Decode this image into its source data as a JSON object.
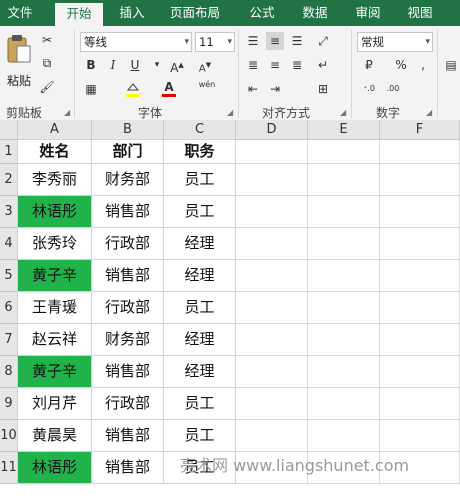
{
  "menu": {
    "tabs": [
      "文件",
      "开始",
      "插入",
      "页面布局",
      "公式",
      "数据",
      "审阅",
      "视图"
    ],
    "active_index": 1
  },
  "ribbon": {
    "clipboard": {
      "paste_label": "粘贴",
      "group_label": "剪贴板"
    },
    "font": {
      "font_name": "等线",
      "font_size": "11",
      "bold_label": "B",
      "italic_label": "I",
      "underline_label": "U",
      "phonetic_label": "wén",
      "font_color_label": "A",
      "group_label": "字体"
    },
    "alignment": {
      "group_label": "对齐方式"
    },
    "number": {
      "format": "常规",
      "percent_label": "%",
      "group_label": "数字"
    }
  },
  "sheet": {
    "columns": [
      "A",
      "B",
      "C",
      "D",
      "E",
      "F"
    ],
    "row_numbers": [
      "1",
      "2",
      "3",
      "4",
      "5",
      "6",
      "7",
      "8",
      "9",
      "10",
      "11"
    ],
    "rows": [
      {
        "cells": [
          "姓名",
          "部门",
          "职务"
        ],
        "highlight": false,
        "bold": true
      },
      {
        "cells": [
          "李秀丽",
          "财务部",
          "员工"
        ],
        "highlight": false
      },
      {
        "cells": [
          "林语彤",
          "销售部",
          "员工"
        ],
        "highlight": true
      },
      {
        "cells": [
          "张秀玲",
          "行政部",
          "经理"
        ],
        "highlight": false
      },
      {
        "cells": [
          "黄子辛",
          "销售部",
          "经理"
        ],
        "highlight": true
      },
      {
        "cells": [
          "王青瑗",
          "行政部",
          "员工"
        ],
        "highlight": false
      },
      {
        "cells": [
          "赵云祥",
          "财务部",
          "经理"
        ],
        "highlight": false
      },
      {
        "cells": [
          "黄子辛",
          "销售部",
          "经理"
        ],
        "highlight": true
      },
      {
        "cells": [
          "刘月芹",
          "行政部",
          "员工"
        ],
        "highlight": false
      },
      {
        "cells": [
          "黄晨昊",
          "销售部",
          "员工"
        ],
        "highlight": false
      },
      {
        "cells": [
          "林语彤",
          "销售部",
          "员工"
        ],
        "highlight": true
      }
    ],
    "highlight_color": "#21b24c",
    "table_border_color": "#f3c9a6"
  },
  "watermark": "亮术网 www.liangshunet.com"
}
